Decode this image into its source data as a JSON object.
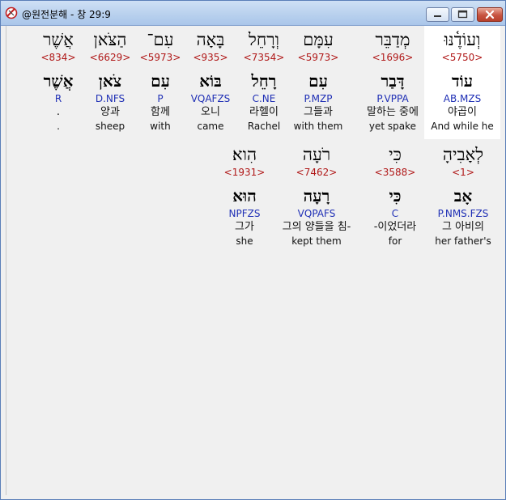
{
  "window": {
    "title": "@원전분해 - 창 29:9"
  },
  "words_row1": [
    {
      "heb": "וְעוֹדֶ֫נּוּ",
      "strong": "<5750>",
      "lemma": "עוֹד",
      "morph": "AB.MZS",
      "kor": "야곱이",
      "eng": "And while he"
    },
    {
      "heb": "מְדַבֵּר",
      "strong": "<1696>",
      "lemma": "דָּבַר",
      "morph": "P.VPPA",
      "kor": "말하는 중에",
      "eng": "yet spake"
    },
    {
      "heb": "עִמָּם",
      "strong": "<5973>",
      "lemma": "עִם",
      "morph": "P.MZP",
      "kor": "그들과",
      "eng": "with them"
    },
    {
      "heb": "וְרָחֵל",
      "strong": "<7354>",
      "lemma": "רָחֵל",
      "morph": "C.NE",
      "kor": "라헬이",
      "eng": "Rachel"
    },
    {
      "heb": "בָּאָה",
      "strong": "<935>",
      "lemma": "בּוֹא",
      "morph": "VQAFZS",
      "kor": "오니",
      "eng": "came"
    },
    {
      "heb": "עִם־",
      "strong": "<5973>",
      "lemma": "עִם",
      "morph": "P",
      "kor": "함께",
      "eng": "with"
    },
    {
      "heb": "הַצֹּאן",
      "strong": "<6629>",
      "lemma": "צֹאן",
      "morph": "D.NFS",
      "kor": "양과",
      "eng": "sheep"
    },
    {
      "heb": "אֲשֶׁר",
      "strong": "<834>",
      "lemma": "אֲשֶׁר",
      "morph": "R",
      "kor": ".",
      "eng": "."
    }
  ],
  "words_row2": [
    {
      "heb": "לְאָבִיהָ",
      "strong": "<1>",
      "lemma": "אָב",
      "morph": "P.NMS.FZS",
      "kor": "그 아비의",
      "eng": "her father's"
    },
    {
      "heb": "כִּי",
      "strong": "<3588>",
      "lemma": "כִּי",
      "morph": "C",
      "kor": "-이었더라",
      "eng": "for"
    },
    {
      "heb": "רֹעָה",
      "strong": "<7462>",
      "lemma": "רָעָה",
      "morph": "VQPAFS",
      "kor": "그의 양들을 침-",
      "eng": "kept them"
    },
    {
      "heb": "הִוא׃",
      "strong": "<1931>",
      "lemma": "הוּא",
      "morph": "NPFZS",
      "kor": "그가",
      "eng": "she"
    }
  ]
}
